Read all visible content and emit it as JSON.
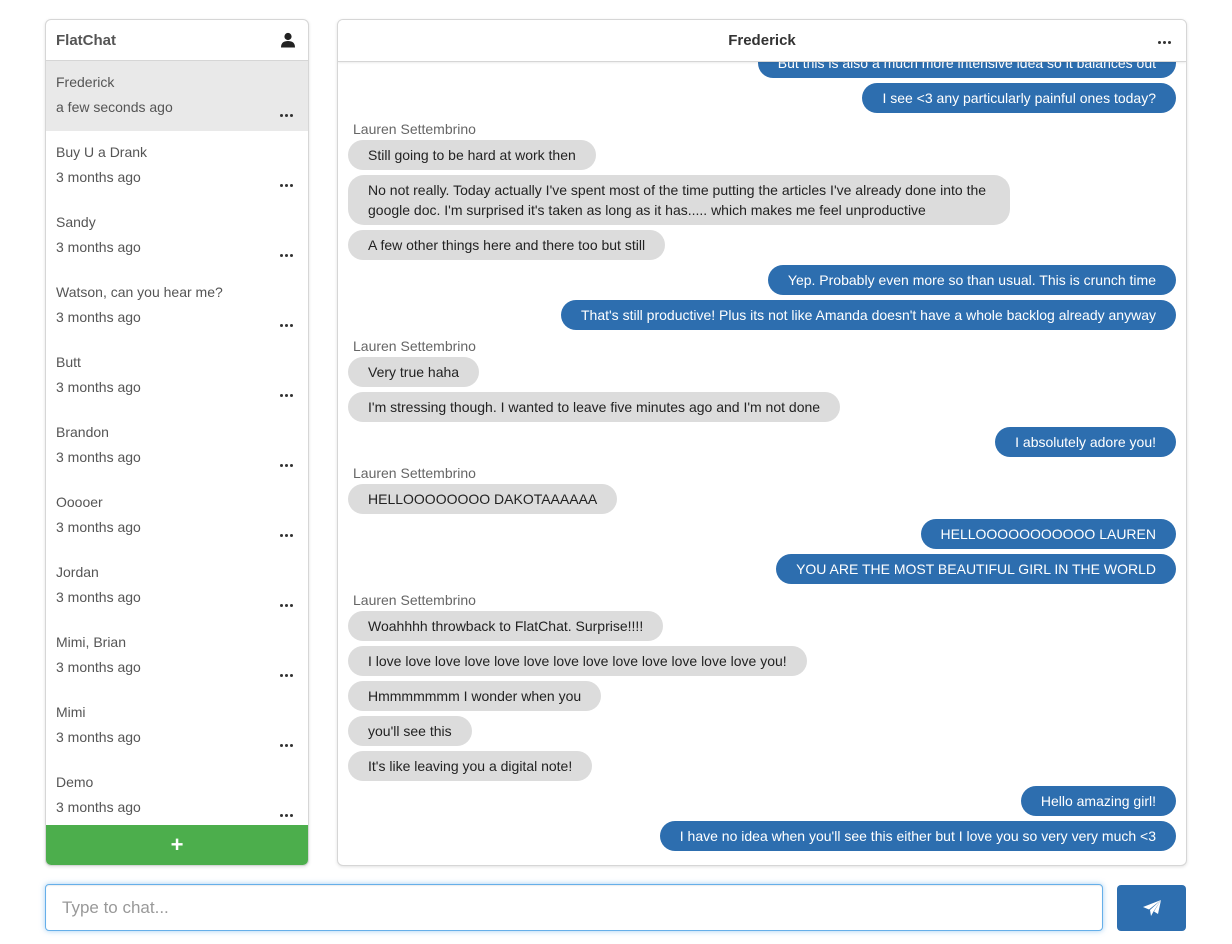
{
  "sidebar": {
    "title": "FlatChat",
    "user_icon": "user-icon",
    "add_icon": "plus-icon",
    "add_label": "+",
    "conversations": [
      {
        "name": "Frederick",
        "time": "a few seconds ago",
        "active": true
      },
      {
        "name": "Buy U a Drank",
        "time": "3 months ago"
      },
      {
        "name": "Sandy",
        "time": "3 months ago"
      },
      {
        "name": "Watson, can you hear me?",
        "time": "3 months ago"
      },
      {
        "name": "Butt",
        "time": "3 months ago"
      },
      {
        "name": "Brandon",
        "time": "3 months ago"
      },
      {
        "name": "Ooooer",
        "time": "3 months ago"
      },
      {
        "name": "Jordan",
        "time": "3 months ago"
      },
      {
        "name": "Mimi, Brian",
        "time": "3 months ago"
      },
      {
        "name": "Mimi",
        "time": "3 months ago"
      },
      {
        "name": "Demo",
        "time": "3 months ago"
      }
    ]
  },
  "chat": {
    "title": "Frederick",
    "messages": [
      {
        "dir": "out",
        "text": "But this is also a much more intensive idea so it balances out"
      },
      {
        "dir": "out",
        "text": "I see <3 any particularly painful ones today?"
      },
      {
        "dir": "in",
        "sender": "Lauren Settembrino",
        "text": "Still going to be hard at work then"
      },
      {
        "dir": "in",
        "text": "No not really. Today actually I've spent most of the time putting the articles I've already done into the google doc. I'm surprised it's taken as long as it has..... which makes me feel unproductive"
      },
      {
        "dir": "in",
        "text": "A few other things here and there too but still"
      },
      {
        "dir": "out",
        "text": "Yep. Probably even more so than usual. This is crunch time"
      },
      {
        "dir": "out",
        "text": "That's still productive! Plus its not like Amanda doesn't have a whole backlog already anyway"
      },
      {
        "dir": "in",
        "sender": "Lauren Settembrino",
        "text": "Very true haha"
      },
      {
        "dir": "in",
        "text": "I'm stressing though. I wanted to leave five minutes ago and I'm not done"
      },
      {
        "dir": "out",
        "text": "I absolutely adore you!"
      },
      {
        "dir": "in",
        "sender": "Lauren Settembrino",
        "text": "HELLOOOOOOOO DAKOTAAAAAA"
      },
      {
        "dir": "out",
        "text": "HELLOOOOOOOOOOO LAUREN"
      },
      {
        "dir": "out",
        "text": "YOU ARE THE MOST BEAUTIFUL GIRL IN THE WORLD"
      },
      {
        "dir": "in",
        "sender": "Lauren Settembrino",
        "text": "Woahhhh throwback to FlatChat. Surprise!!!!"
      },
      {
        "dir": "in",
        "text": "I love love love love love love love love love love love love love you!"
      },
      {
        "dir": "in",
        "text": "Hmmmmmmm I wonder when you"
      },
      {
        "dir": "in",
        "text": "you'll see this"
      },
      {
        "dir": "in",
        "text": "It's like leaving you a digital note!"
      },
      {
        "dir": "out",
        "text": "Hello amazing girl!"
      },
      {
        "dir": "out",
        "text": "I have no idea when you'll see this either but I love you so very very much <3"
      }
    ]
  },
  "composer": {
    "placeholder": "Type to chat...",
    "value": "",
    "send_icon": "paper-plane-icon"
  },
  "colors": {
    "outgoing_bubble": "#2d6eaf",
    "incoming_bubble": "#dcdcdc",
    "add_button": "#4cae4c",
    "active_conversation": "#e9e9e9"
  }
}
